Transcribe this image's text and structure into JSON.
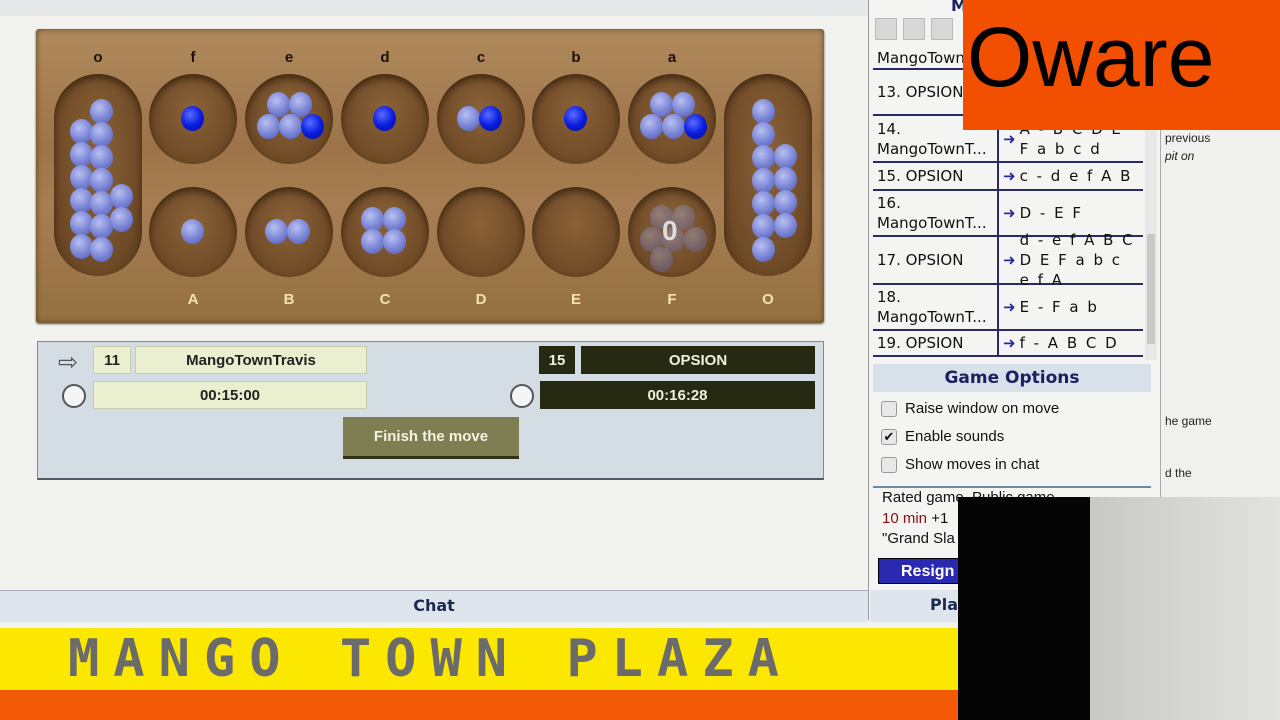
{
  "board": {
    "top_labels": [
      "o",
      "f",
      "e",
      "d",
      "c",
      "b",
      "a"
    ],
    "bottom_labels": [
      "A",
      "B",
      "C",
      "D",
      "E",
      "F",
      "O"
    ],
    "top_pits": [
      {
        "label": "f",
        "seeds": 1,
        "new": 1
      },
      {
        "label": "e",
        "seeds": 5,
        "new": 1
      },
      {
        "label": "d",
        "seeds": 1,
        "new": 1
      },
      {
        "label": "c",
        "seeds": 2,
        "new": 1
      },
      {
        "label": "b",
        "seeds": 1,
        "new": 1
      },
      {
        "label": "a",
        "seeds": 5,
        "new": 1
      }
    ],
    "bottom_pits": [
      {
        "label": "A",
        "seeds": 1
      },
      {
        "label": "B",
        "seeds": 2
      },
      {
        "label": "C",
        "seeds": 4
      },
      {
        "label": "D",
        "seeds": 0
      },
      {
        "label": "E",
        "seeds": 0
      },
      {
        "label": "F",
        "seeds": 0,
        "emptied_from": 6
      }
    ],
    "left_store": {
      "label": "o",
      "seeds": 15
    },
    "right_store": {
      "label": "O",
      "seeds": 11
    },
    "hover_count": "0",
    "seed_color": "#7e88d8",
    "new_seed_color": "#0a1ee0"
  },
  "players": {
    "me": {
      "score": "11",
      "name": "MangoTownTravis",
      "clock": "00:15:00",
      "to_move": true
    },
    "opponent": {
      "score": "15",
      "name": "OPSION",
      "clock": "00:16:28"
    }
  },
  "finish_label": "Finish the move",
  "moves": [
    {
      "who": "MangoTown",
      "move": ""
    },
    {
      "who": "13. OPSION",
      "move": ""
    },
    {
      "who": "14. MangoTownT...",
      "move": "A - B C D E F a b c d"
    },
    {
      "who": "15. OPSION",
      "move": "c - d e f A B"
    },
    {
      "who": "16. MangoTownT...",
      "move": "D - E F"
    },
    {
      "who": "17. OPSION",
      "move": "d - e f A B C D E F a b c e f A"
    },
    {
      "who": "18. MangoTownT...",
      "move": "E - F a b"
    },
    {
      "who": "19. OPSION",
      "move": "f - A B C D"
    }
  ],
  "options": {
    "title": "Game Options",
    "items": [
      {
        "label": "Raise window on move",
        "checked": false
      },
      {
        "label": "Enable sounds",
        "checked": true
      },
      {
        "label": "Show moves in chat",
        "checked": false
      }
    ]
  },
  "info": {
    "line1": "Rated game, Public game",
    "time": "10 min",
    "inc": "+1",
    "line3": "\"Grand Sla"
  },
  "resign_label": "Resign",
  "side_text": [
    "previous",
    "pit on",
    "he game",
    "d the"
  ],
  "chat_label": "Chat",
  "players_label": "Pla",
  "sidebar_header": "M",
  "banner": "MANGO TOWN PLAZA",
  "logo": "Oware",
  "colors": {
    "accent_orange": "#f25000",
    "banner_yellow": "#fbe700",
    "dark_panel": "#262a12",
    "resign_blue": "#2a2ab0"
  }
}
